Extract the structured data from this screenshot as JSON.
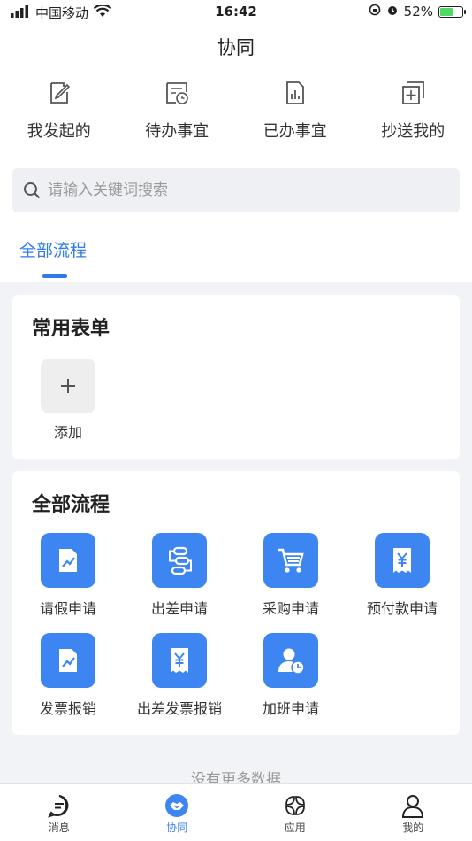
{
  "status_bar": {
    "carrier": "中国移动",
    "time": "16:42",
    "battery": "52%",
    "battery_level": 0.52
  },
  "header": {
    "title": "协同"
  },
  "quick_actions": [
    {
      "label": "我发起的",
      "icon": "edit-doc-icon"
    },
    {
      "label": "待办事宜",
      "icon": "pending-clock-icon"
    },
    {
      "label": "已办事宜",
      "icon": "done-chart-icon"
    },
    {
      "label": "抄送我的",
      "icon": "copy-add-icon"
    }
  ],
  "search": {
    "placeholder": "请输入关键词搜索"
  },
  "tabs": [
    {
      "label": "全部流程",
      "active": true
    }
  ],
  "common_forms": {
    "title": "常用表单",
    "add_label": "添加"
  },
  "all_flows": {
    "title": "全部流程",
    "items": [
      {
        "label": "请假申请",
        "icon": "chart-doc-icon"
      },
      {
        "label": "出差申请",
        "icon": "travel-route-icon"
      },
      {
        "label": "采购申请",
        "icon": "shopping-cart-icon"
      },
      {
        "label": "预付款申请",
        "icon": "yen-receipt-icon"
      },
      {
        "label": "发票报销",
        "icon": "chart-doc-icon"
      },
      {
        "label": "出差发票报销",
        "icon": "yen-receipt-icon"
      },
      {
        "label": "加班申请",
        "icon": "user-clock-icon"
      }
    ]
  },
  "footer_text": "没有更多数据",
  "tabbar": [
    {
      "label": "消息",
      "icon": "message-icon",
      "active": false
    },
    {
      "label": "协同",
      "icon": "handshake-icon",
      "active": true
    },
    {
      "label": "应用",
      "icon": "apps-icon",
      "active": false
    },
    {
      "label": "我的",
      "icon": "profile-icon",
      "active": false
    }
  ],
  "colors": {
    "accent": "#3d86f1",
    "tab_active": "#2f7bea",
    "background": "#f2f3f7"
  }
}
